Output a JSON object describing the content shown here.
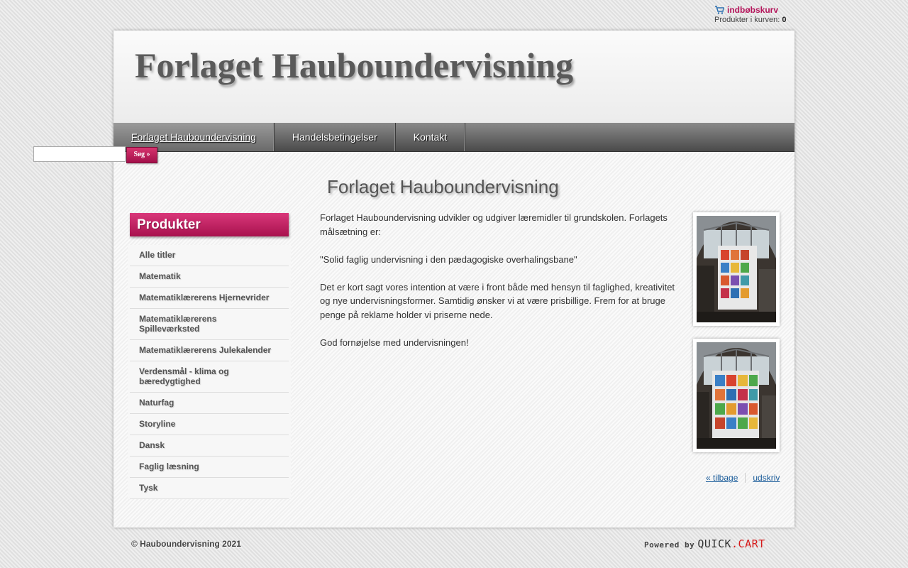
{
  "cart": {
    "label": "indbøbskurv",
    "count_label": "Produkter i kurven:",
    "count": "0"
  },
  "header": {
    "site_title": "Forlaget Hauboundervisning"
  },
  "nav": {
    "items": [
      {
        "label": "Forlaget Hauboundervisning",
        "active": true
      },
      {
        "label": "Handelsbetingelser",
        "active": false
      },
      {
        "label": "Kontakt",
        "active": false
      }
    ]
  },
  "search": {
    "value": "",
    "button_label": "Søg »"
  },
  "sidebar": {
    "heading": "Produkter",
    "items": [
      {
        "label": "Alle titler"
      },
      {
        "label": "Matematik"
      },
      {
        "label": "Matematiklærerens Hjernevrider"
      },
      {
        "label": "Matematiklærerens Spilleværksted"
      },
      {
        "label": "Matematiklærerens Julekalender"
      },
      {
        "label": "Verdensmål - klima og bæredygtighed"
      },
      {
        "label": "Naturfag"
      },
      {
        "label": "Storyline"
      },
      {
        "label": "Dansk"
      },
      {
        "label": "Faglig læsning"
      },
      {
        "label": "Tysk"
      }
    ]
  },
  "main": {
    "heading": "Forlaget Hauboundervisning",
    "paragraphs": [
      "Forlaget Hauboundervisning udvikler og udgiver læremidler til grundskolen. Forlagets målsætning er:",
      "\"Solid faglig undervisning i den pædagogiske overhalingsbane\"",
      "Det er kort sagt vores intention at være i front både med hensyn til faglighed, kreativitet og nye undervisningsformer. Samtidig ønsker vi at være prisbillige. Frem for at bruge penge på reklame holder vi priserne nede.",
      "God fornøjelse med undervisningen!"
    ],
    "back_label": "« tilbage",
    "print_label": "udskriv"
  },
  "footer": {
    "copyright": "© Hauboundervisning 2021",
    "powered_prefix": "Powered by",
    "powered_brand_a": "QUICK",
    "powered_dot": ".",
    "powered_brand_b": "CART"
  },
  "colors": {
    "accent": "#b4145a",
    "nav_dark": "#4a4a4a",
    "link": "#1a5c9a"
  }
}
